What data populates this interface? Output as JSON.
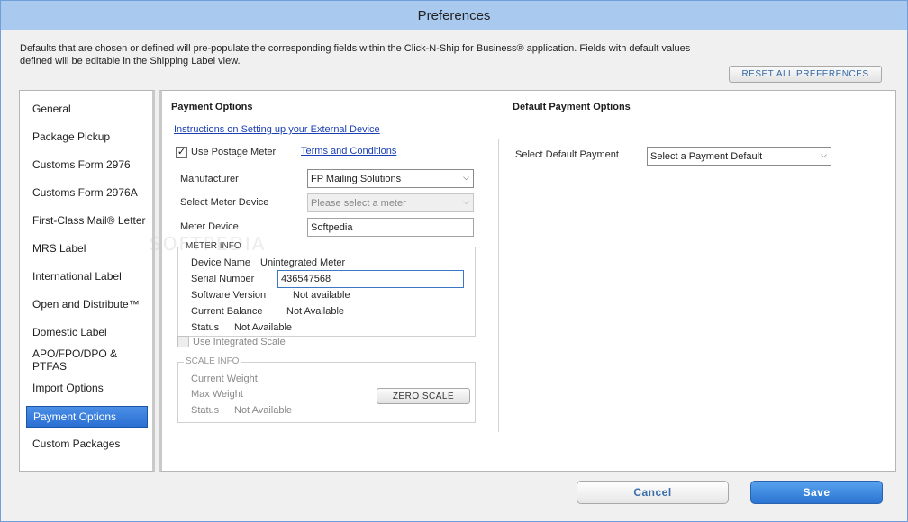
{
  "window": {
    "title": "Preferences"
  },
  "intro_text_line1": "Defaults that are chosen or defined will pre-populate the corresponding fields within the Click-N-Ship for Business® application.  Fields with default values",
  "intro_text_line2": "defined will be editable in the Shipping Label view.",
  "reset_button": "RESET ALL PREFERENCES",
  "sidebar": {
    "items": [
      {
        "label": "General"
      },
      {
        "label": "Package Pickup"
      },
      {
        "label": "Customs Form 2976"
      },
      {
        "label": "Customs Form 2976A"
      },
      {
        "label": "First-Class Mail® Letter"
      },
      {
        "label": "MRS Label"
      },
      {
        "label": "International Label"
      },
      {
        "label": "Open and Distribute™"
      },
      {
        "label": "Domestic Label"
      },
      {
        "label": "APO/FPO/DPO & PTFAS"
      },
      {
        "label": "Import Options"
      },
      {
        "label": "Payment Options"
      },
      {
        "label": "Custom Packages"
      }
    ],
    "selected": "Payment Options"
  },
  "payment": {
    "title": "Payment Options",
    "instructions_link": "Instructions on Setting up your External Device",
    "use_postage_meter_label": "Use Postage Meter",
    "use_postage_meter_checked": "✓",
    "terms_link": "Terms and Conditions",
    "manufacturer_label": "Manufacturer",
    "manufacturer_value": "FP Mailing Solutions",
    "select_meter_label": "Select Meter Device",
    "select_meter_value": "Please select a meter",
    "meter_device_label": "Meter Device",
    "meter_device_value": "Softpedia",
    "meter_info": {
      "legend": "METER INFO",
      "device_name_label": "Device Name",
      "device_name_value": "Unintegrated Meter",
      "serial_label": "Serial Number",
      "serial_value": "436547568",
      "software_label": "Software Version",
      "software_value": "Not available",
      "balance_label": "Current Balance",
      "balance_value": "Not Available",
      "status_label": "Status",
      "status_value": "Not Available"
    },
    "use_integrated_scale_label": "Use Integrated Scale",
    "scale_info": {
      "legend": "SCALE INFO",
      "current_weight_label": "Current Weight",
      "max_weight_label": "Max Weight",
      "status_label": "Status",
      "status_value": "Not Available",
      "zero_scale_button": "ZERO SCALE"
    }
  },
  "default_payment": {
    "title": "Default Payment Options",
    "select_label": "Select Default Payment",
    "select_value": "Select a Payment Default"
  },
  "footer": {
    "cancel": "Cancel",
    "save": "Save"
  },
  "watermark": "SOFTPEDIA",
  "icons": {
    "dropdown": "chevron-down-icon",
    "check": "checkmark-icon"
  },
  "colors": {
    "accent": "#2a6fd3",
    "link": "#1a3fb3",
    "titlebar": "#a9c9ee"
  }
}
